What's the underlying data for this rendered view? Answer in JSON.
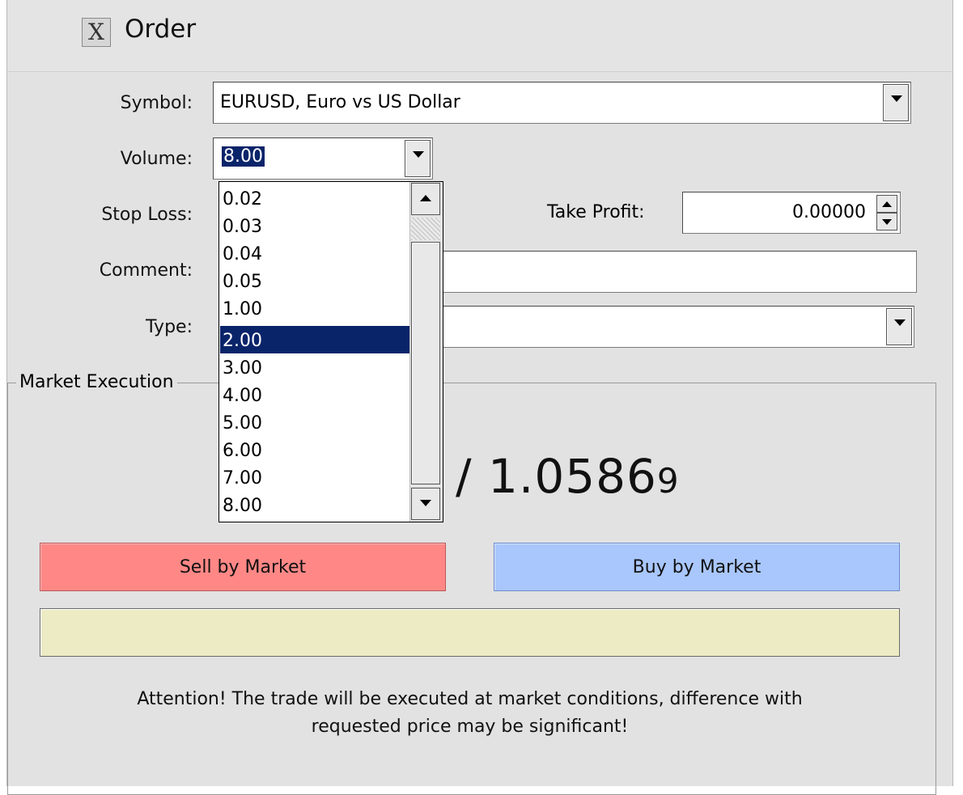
{
  "window": {
    "title": "Order",
    "close_glyph": "X"
  },
  "form": {
    "symbol_label": "Symbol:",
    "symbol_value": "EURUSD, Euro vs US Dollar",
    "volume_label": "Volume:",
    "volume_value": "8.00",
    "stop_loss_label": "Stop Loss:",
    "take_profit_label": "Take Profit:",
    "take_profit_value": "0.00000",
    "comment_label": "Comment:",
    "comment_value": "",
    "type_label": "Type:",
    "type_value": ""
  },
  "volume_dropdown": {
    "options": [
      "0.02",
      "0.03",
      "0.04",
      "0.05",
      "1.00",
      "2.00",
      "3.00",
      "4.00",
      "5.00",
      "6.00",
      "7.00",
      "8.00"
    ],
    "highlighted": "2.00"
  },
  "market": {
    "group_label": "Market Execution",
    "price_text": "/ 1.0586",
    "price_small_digit": "9",
    "sell_label": "Sell by Market",
    "buy_label": "Buy by Market",
    "status_text": "",
    "attention_line1": "Attention! The trade will be executed at market conditions, difference with",
    "attention_line2": "requested price may be significant!"
  },
  "colors": {
    "sell": "#ff8886",
    "buy": "#a9c7fd",
    "highlight": "#0a246a",
    "status_bar": "#ecebc4"
  }
}
